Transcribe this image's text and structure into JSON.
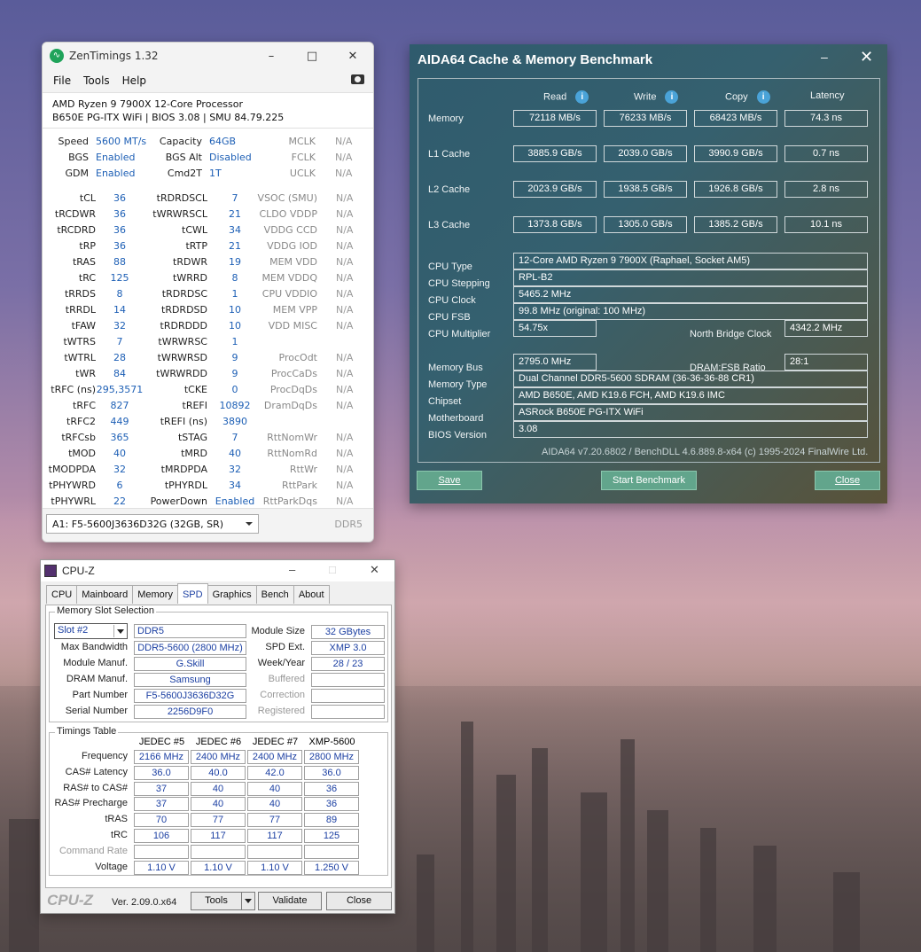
{
  "zentimings": {
    "title": "ZenTimings 1.32",
    "menu": [
      "File",
      "Tools",
      "Help"
    ],
    "cpu_name": "AMD Ryzen 9 7900X 12-Core Processor",
    "board_info": "B650E PG-ITX WiFi | BIOS 3.08 | SMU 84.79.225",
    "top": [
      [
        "Speed",
        "5600 MT/s",
        "Capacity",
        "64GB",
        "MCLK",
        "N/A"
      ],
      [
        "BGS",
        "Enabled",
        "BGS Alt",
        "Disabled",
        "FCLK",
        "N/A"
      ],
      [
        "GDM",
        "Enabled",
        "Cmd2T",
        "1T",
        "UCLK",
        "N/A"
      ]
    ],
    "rows": [
      [
        "tCL",
        "36",
        "tRDRDSCL",
        "7",
        "VSOC (SMU)",
        "N/A"
      ],
      [
        "tRCDWR",
        "36",
        "tWRWRSCL",
        "21",
        "CLDO VDDP",
        "N/A"
      ],
      [
        "tRCDRD",
        "36",
        "tCWL",
        "34",
        "VDDG CCD",
        "N/A"
      ],
      [
        "tRP",
        "36",
        "tRTP",
        "21",
        "VDDG IOD",
        "N/A"
      ],
      [
        "tRAS",
        "88",
        "tRDWR",
        "19",
        "MEM VDD",
        "N/A"
      ],
      [
        "tRC",
        "125",
        "tWRRD",
        "8",
        "MEM VDDQ",
        "N/A"
      ],
      [
        "tRRDS",
        "8",
        "tRDRDSC",
        "1",
        "CPU VDDIO",
        "N/A"
      ],
      [
        "tRRDL",
        "14",
        "tRDRDSD",
        "10",
        "MEM VPP",
        "N/A"
      ],
      [
        "tFAW",
        "32",
        "tRDRDDD",
        "10",
        "VDD MISC",
        "N/A"
      ],
      [
        "tWTRS",
        "7",
        "tWRWRSC",
        "1",
        "",
        ""
      ],
      [
        "tWTRL",
        "28",
        "tWRWRSD",
        "9",
        "ProcOdt",
        "N/A"
      ],
      [
        "tWR",
        "84",
        "tWRWRDD",
        "9",
        "ProcCaDs",
        "N/A"
      ],
      [
        "tRFC (ns)",
        "295,3571",
        "tCKE",
        "0",
        "ProcDqDs",
        "N/A"
      ],
      [
        "tRFC",
        "827",
        "tREFI",
        "10892",
        "DramDqDs",
        "N/A"
      ],
      [
        "tRFC2",
        "449",
        "tREFI (ns)",
        "3890",
        "",
        ""
      ],
      [
        "tRFCsb",
        "365",
        "tSTAG",
        "7",
        "RttNomWr",
        "N/A"
      ],
      [
        "tMOD",
        "40",
        "tMRD",
        "40",
        "RttNomRd",
        "N/A"
      ],
      [
        "tMODPDA",
        "32",
        "tMRDPDA",
        "32",
        "RttWr",
        "N/A"
      ],
      [
        "tPHYWRD",
        "6",
        "tPHYRDL",
        "34",
        "RttPark",
        "N/A"
      ],
      [
        "tPHYWRL",
        "22",
        "PowerDown",
        "Enabled",
        "RttParkDqs",
        "N/A"
      ]
    ],
    "module_select": "A1: F5-5600J3636D32G (32GB, SR)",
    "mem_type": "DDR5"
  },
  "aida": {
    "title": "AIDA64 Cache & Memory Benchmark",
    "headers": [
      "Read",
      "Write",
      "Copy",
      "Latency"
    ],
    "bench": [
      [
        "Memory",
        "72118 MB/s",
        "76233 MB/s",
        "68423 MB/s",
        "74.3 ns"
      ],
      [
        "L1 Cache",
        "3885.9 GB/s",
        "2039.0 GB/s",
        "3990.9 GB/s",
        "0.7 ns"
      ],
      [
        "L2 Cache",
        "2023.9 GB/s",
        "1938.5 GB/s",
        "1926.8 GB/s",
        "2.8 ns"
      ],
      [
        "L3 Cache",
        "1373.8 GB/s",
        "1305.0 GB/s",
        "1385.2 GB/s",
        "10.1 ns"
      ]
    ],
    "cpu_type_label": "CPU Type",
    "cpu_type": "12-Core AMD Ryzen 9 7900X  (Raphael, Socket AM5)",
    "cpu_stepping_label": "CPU Stepping",
    "cpu_stepping": "RPL-B2",
    "cpu_clock_label": "CPU Clock",
    "cpu_clock": "5465.2 MHz",
    "cpu_fsb_label": "CPU FSB",
    "cpu_fsb": "99.8 MHz  (original: 100 MHz)",
    "cpu_mult_label": "CPU Multiplier",
    "cpu_mult": "54.75x",
    "nb_clock_label": "North Bridge Clock",
    "nb_clock": "4342.2 MHz",
    "mem_bus_label": "Memory Bus",
    "mem_bus": "2795.0 MHz",
    "dram_fsb_label": "DRAM:FSB Ratio",
    "dram_fsb": "28:1",
    "mem_type_label": "Memory Type",
    "mem_type": "Dual Channel DDR5-5600 SDRAM  (36-36-36-88 CR1)",
    "chipset_label": "Chipset",
    "chipset": "AMD B650E, AMD K19.6 FCH, AMD K19.6 IMC",
    "mobo_label": "Motherboard",
    "mobo": "ASRock B650E PG-ITX WiFi",
    "bios_label": "BIOS Version",
    "bios": "3.08",
    "footer": "AIDA64 v7.20.6802 / BenchDLL 4.6.889.8-x64  (c) 1995-2024 FinalWire Ltd.",
    "btn_save": "Save",
    "btn_start": "Start Benchmark",
    "btn_close": "Close"
  },
  "cpuz": {
    "title": "CPU-Z",
    "tabs": [
      "CPU",
      "Mainboard",
      "Memory",
      "SPD",
      "Graphics",
      "Bench",
      "About"
    ],
    "slot_group": "Memory Slot Selection",
    "slot": "Slot #2",
    "ddr": "DDR5",
    "labels_left": [
      "Max Bandwidth",
      "Module Manuf.",
      "DRAM Manuf.",
      "Part Number",
      "Serial Number"
    ],
    "values_left": [
      "DDR5-5600 (2800 MHz)",
      "G.Skill",
      "Samsung",
      "F5-5600J3636D32G",
      "2256D9F0"
    ],
    "labels_right": [
      "Module Size",
      "SPD Ext.",
      "Week/Year",
      "Buffered",
      "Correction",
      "Registered"
    ],
    "values_right": [
      "32 GBytes",
      "XMP 3.0",
      "28 / 23",
      "",
      "",
      ""
    ],
    "timings_group": "Timings Table",
    "timing_cols": [
      "JEDEC #5",
      "JEDEC #6",
      "JEDEC #7",
      "XMP-5600"
    ],
    "timing_rows": [
      [
        "Frequency",
        "2166 MHz",
        "2400 MHz",
        "2400 MHz",
        "2800 MHz"
      ],
      [
        "CAS# Latency",
        "36.0",
        "40.0",
        "42.0",
        "36.0"
      ],
      [
        "RAS# to CAS#",
        "37",
        "40",
        "40",
        "36"
      ],
      [
        "RAS# Precharge",
        "37",
        "40",
        "40",
        "36"
      ],
      [
        "tRAS",
        "70",
        "77",
        "77",
        "89"
      ],
      [
        "tRC",
        "106",
        "117",
        "117",
        "125"
      ],
      [
        "Command Rate",
        "",
        "",
        "",
        ""
      ],
      [
        "Voltage",
        "1.10 V",
        "1.10 V",
        "1.10 V",
        "1.250 V"
      ]
    ],
    "brand": "CPU-Z",
    "version": "Ver. 2.09.0.x64",
    "btn_tools": "Tools",
    "btn_validate": "Validate",
    "btn_close": "Close"
  }
}
